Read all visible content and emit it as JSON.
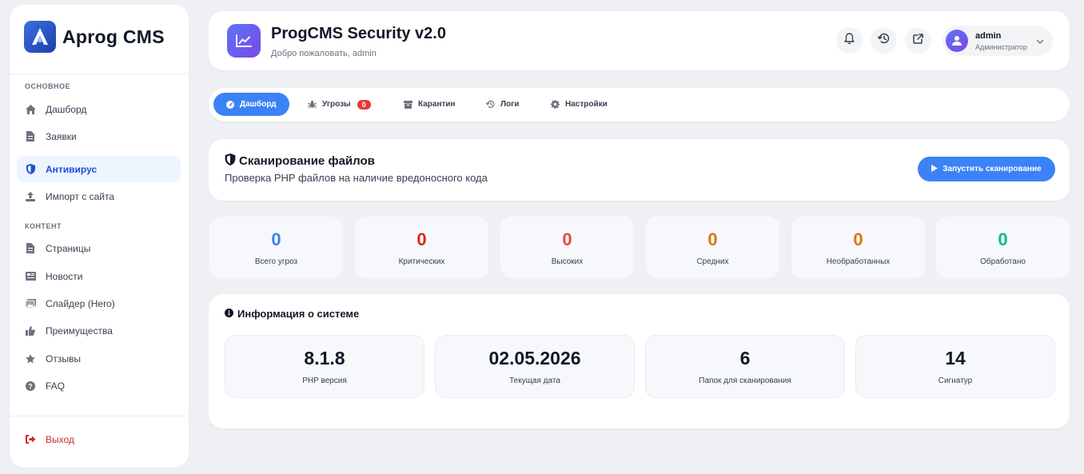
{
  "sidebar": {
    "brand": "Aprog CMS",
    "section_main": "ОСНОВНОЕ",
    "section_content": "КОНТЕНТ",
    "items_main": [
      {
        "label": "Дашборд",
        "icon": "home-icon"
      },
      {
        "label": "Заявки",
        "icon": "document-icon"
      },
      {
        "label": "Антивирус",
        "icon": "shield-icon",
        "active": true
      },
      {
        "label": "Импорт с сайта",
        "icon": "upload-icon"
      }
    ],
    "items_content": [
      {
        "label": "Страницы",
        "icon": "file-icon"
      },
      {
        "label": "Новости",
        "icon": "newspaper-icon"
      },
      {
        "label": "Слайдер (Hero)",
        "icon": "images-icon"
      },
      {
        "label": "Преимущества",
        "icon": "thumbs-up-icon"
      },
      {
        "label": "Отзывы",
        "icon": "star-icon"
      },
      {
        "label": "FAQ",
        "icon": "question-icon"
      }
    ],
    "logout": "Выход"
  },
  "header": {
    "title": "ProgCMS Security v2.0",
    "subtitle": "Добро пожаловать, admin",
    "user": {
      "name": "admin",
      "role": "Администратор"
    }
  },
  "tabs": [
    {
      "label": "Дашборд",
      "icon": "gauge-icon",
      "active": true
    },
    {
      "label": "Угрозы",
      "icon": "bug-icon",
      "badge": "0"
    },
    {
      "label": "Карантин",
      "icon": "archive-icon"
    },
    {
      "label": "Логи",
      "icon": "history-icon"
    },
    {
      "label": "Настройки",
      "icon": "gear-icon"
    }
  ],
  "scan": {
    "title": "Сканирование файлов",
    "subtitle": "Проверка PHP файлов на наличие вредоносного кода",
    "button": "Запустить сканирование"
  },
  "stats": [
    {
      "value": "0",
      "label": "Всего угроз",
      "color": "#3b82f6"
    },
    {
      "value": "0",
      "label": "Критических",
      "color": "#dc2626"
    },
    {
      "value": "0",
      "label": "Высоких",
      "color": "#ef4444"
    },
    {
      "value": "0",
      "label": "Средних",
      "color": "#d97706"
    },
    {
      "value": "0",
      "label": "Необработанных",
      "color": "#d97706"
    },
    {
      "value": "0",
      "label": "Обработано",
      "color": "#10b981"
    }
  ],
  "system": {
    "title": "Информация о системе",
    "items": [
      {
        "value": "8.1.8",
        "label": "PHP версия"
      },
      {
        "value": "02.05.2026",
        "label": "Текущая дата"
      },
      {
        "value": "6",
        "label": "Папок для сканирования"
      },
      {
        "value": "14",
        "label": "Сигнатур"
      }
    ]
  }
}
